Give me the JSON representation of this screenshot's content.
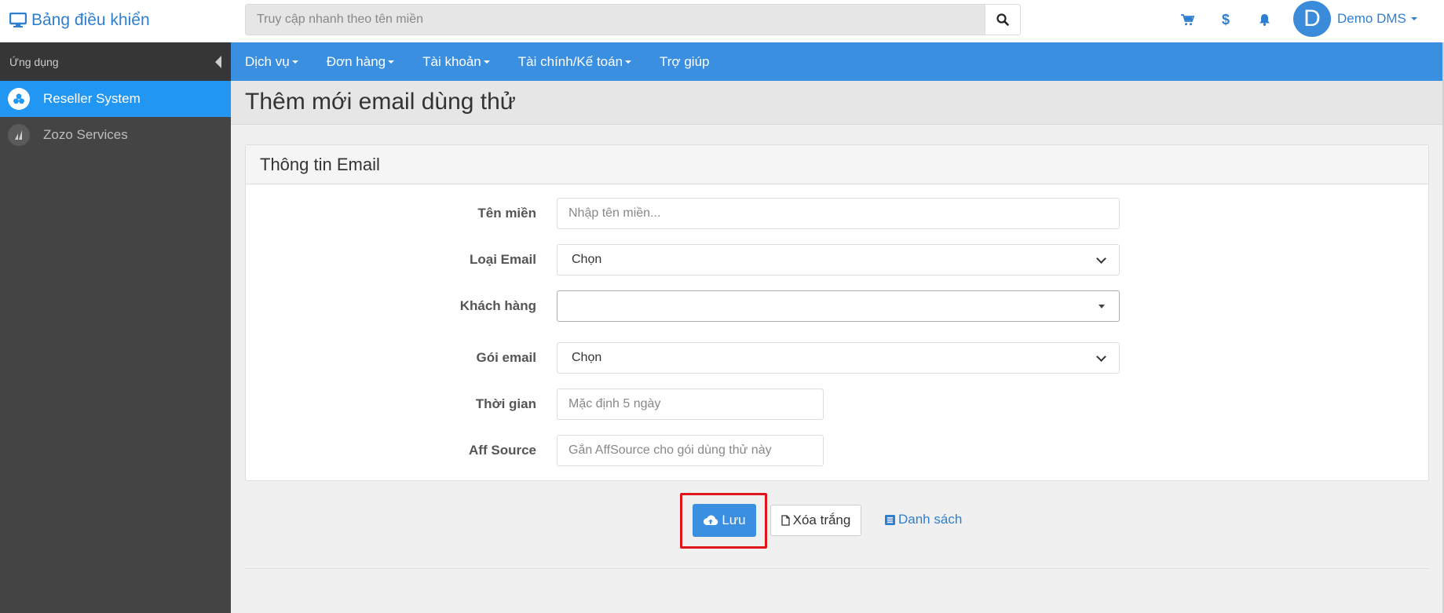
{
  "brand": {
    "title": "Bảng điều khiển",
    "icon": "monitor-icon"
  },
  "search": {
    "placeholder": "Truy cập nhanh theo tên miền"
  },
  "topbar": {
    "cart_icon": "cart-icon",
    "dollar_symbol": "$",
    "bell_icon": "bell-icon",
    "avatar_letter": "D",
    "user_name": "Demo DMS"
  },
  "sidebar": {
    "header": "Ứng dụng",
    "items": [
      {
        "label": "Reseller System",
        "icon": "cluster-icon",
        "active": true
      },
      {
        "label": "Zozo Services",
        "icon": "zozo-logo-icon",
        "active": false
      }
    ]
  },
  "menubar": {
    "items": [
      {
        "label": "Dịch vụ",
        "dropdown": true
      },
      {
        "label": "Đơn hàng",
        "dropdown": true
      },
      {
        "label": "Tài khoản",
        "dropdown": true
      },
      {
        "label": "Tài chính/Kế toán",
        "dropdown": true
      },
      {
        "label": "Trợ giúp",
        "dropdown": false
      }
    ]
  },
  "page": {
    "title": "Thêm mới email dùng thử"
  },
  "panel": {
    "heading": "Thông tin Email",
    "fields": {
      "domain": {
        "label": "Tên miền",
        "placeholder": "Nhập tên miền..."
      },
      "email_type": {
        "label": "Loại Email",
        "value": "Chọn"
      },
      "customer": {
        "label": "Khách hàng",
        "value": ""
      },
      "email_package": {
        "label": "Gói email",
        "value": "Chọn"
      },
      "duration": {
        "label": "Thời gian",
        "placeholder": "Mặc định 5 ngày"
      },
      "aff_source": {
        "label": "Aff Source",
        "placeholder": "Gắn AffSource cho gói dùng thử này"
      }
    }
  },
  "actions": {
    "save_label": "Lưu",
    "clear_label": "Xóa trắng",
    "list_label": "Danh sách"
  },
  "colors": {
    "primary": "#3b8fe0",
    "active_sidebar": "#2196f3",
    "sidebar_bg": "#444444",
    "highlight": "#e0161c"
  }
}
